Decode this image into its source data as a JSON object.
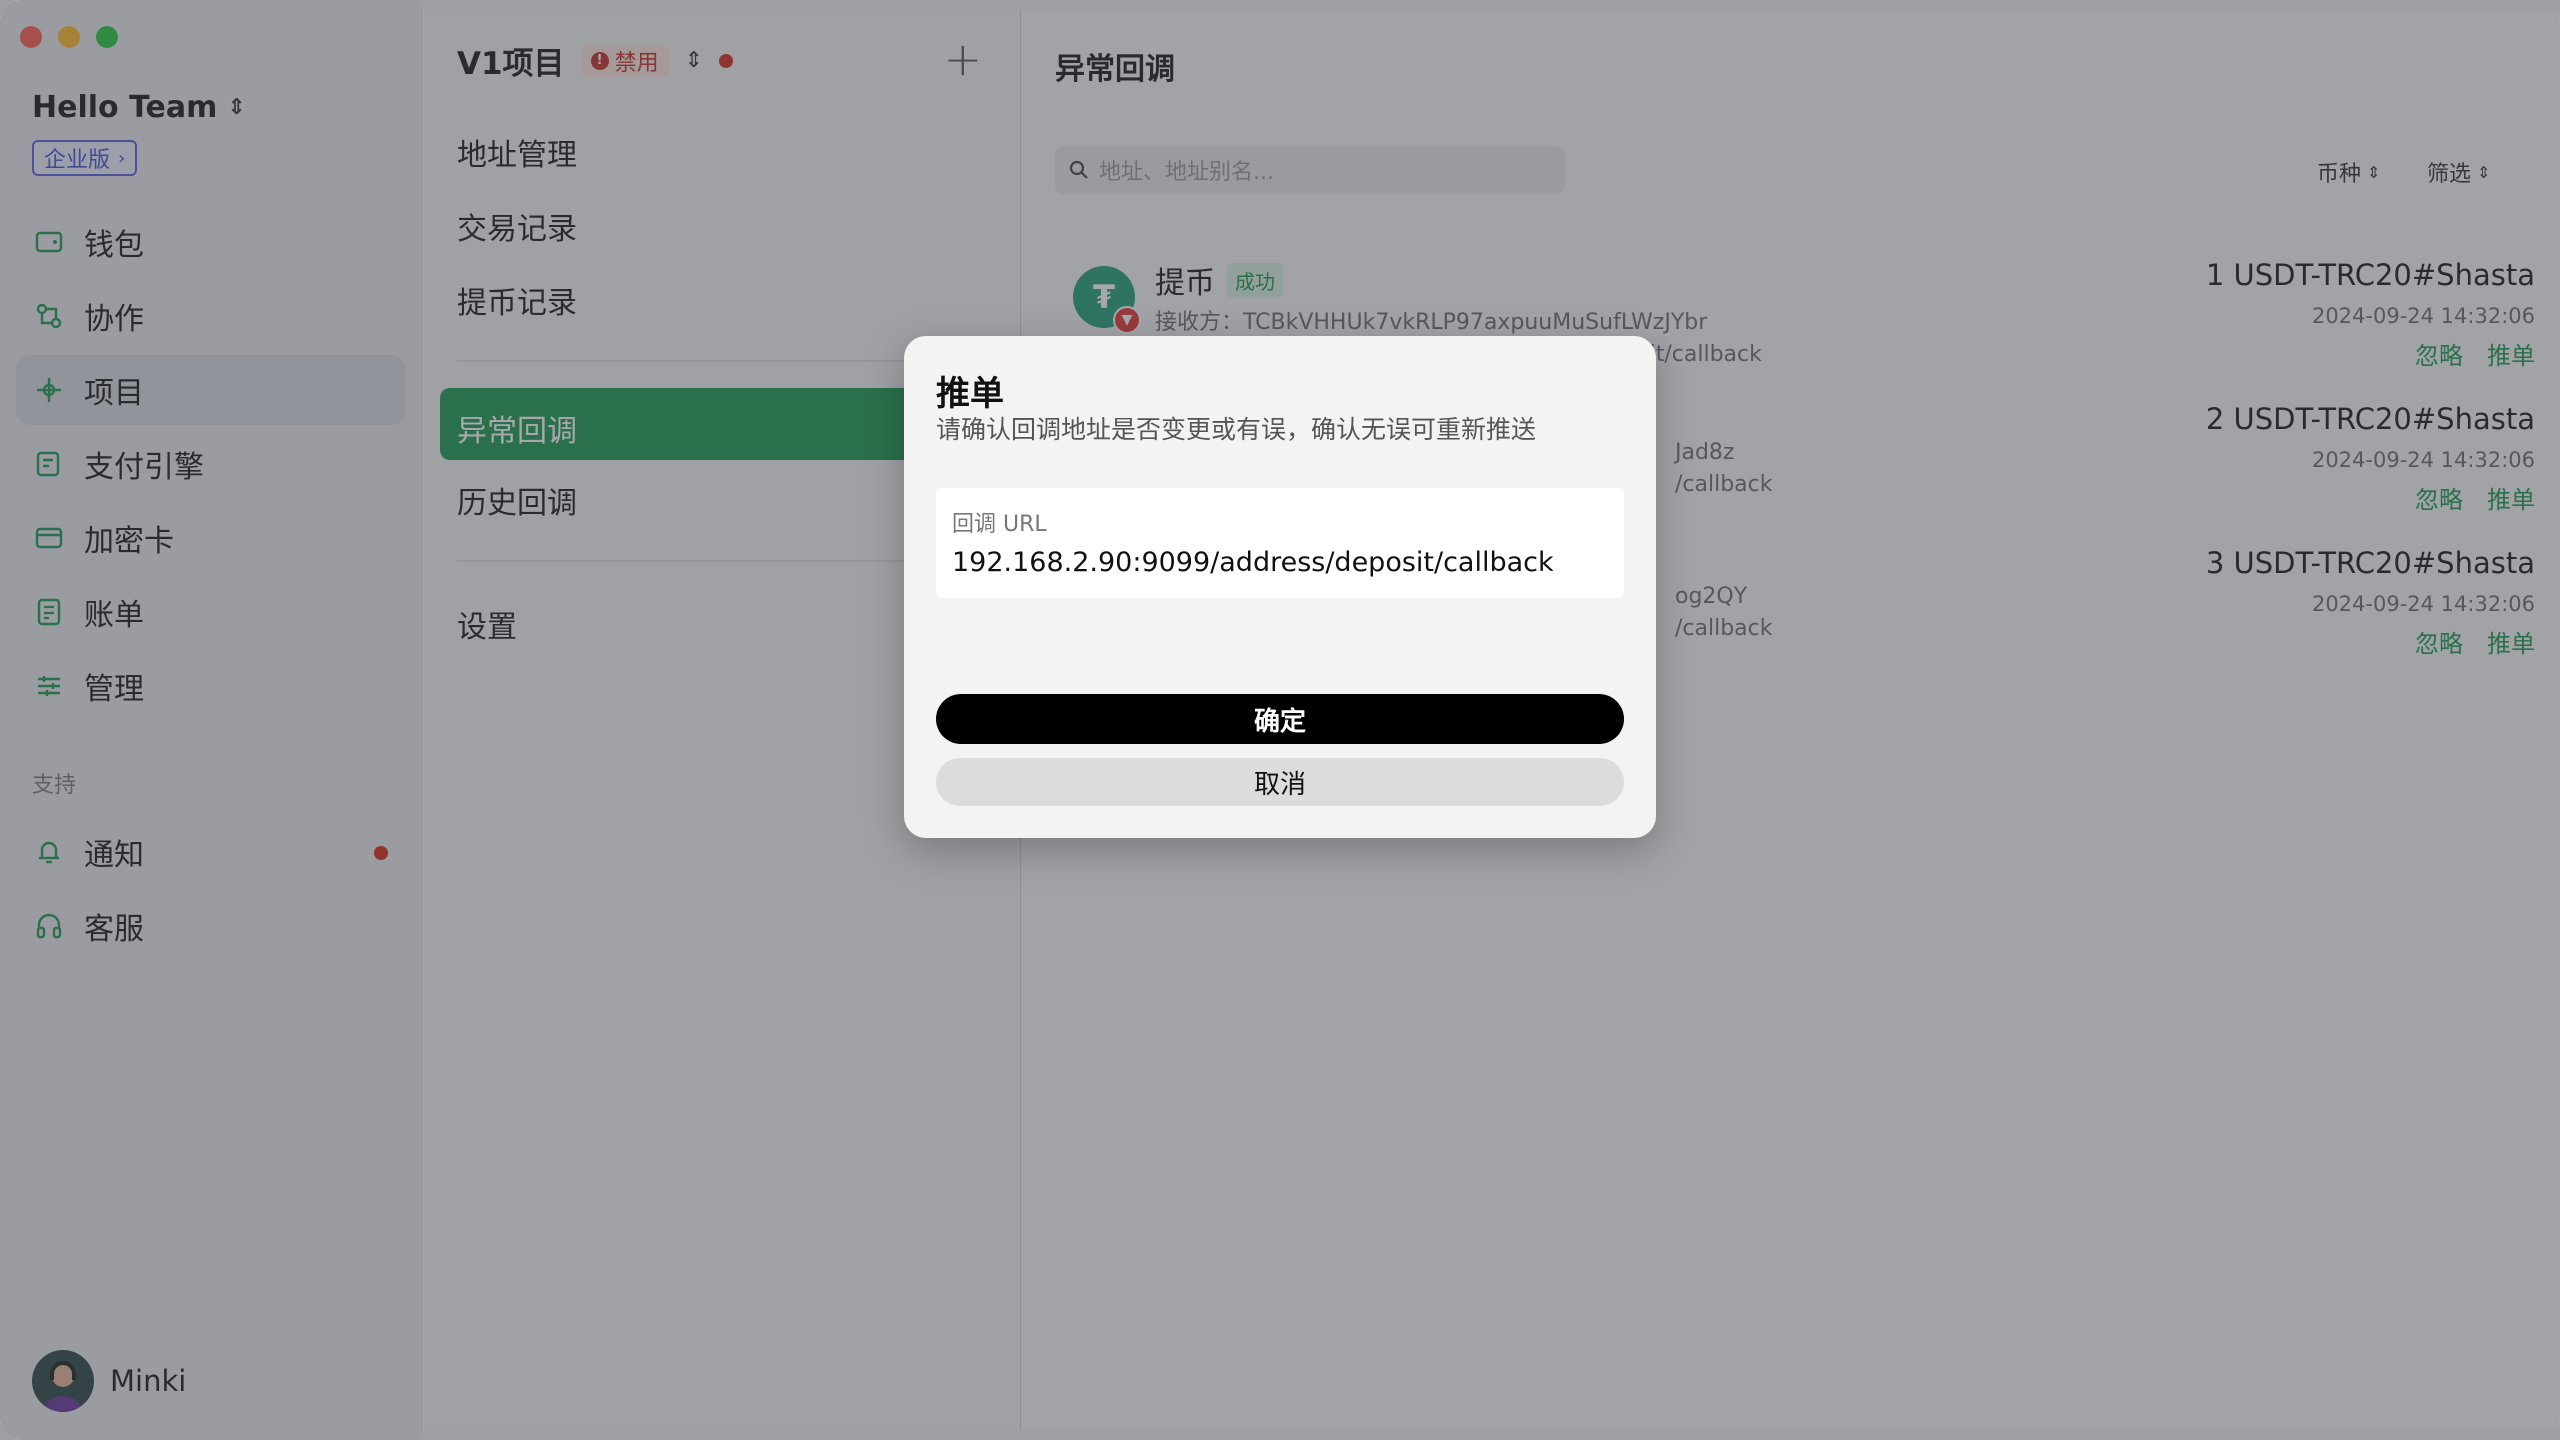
{
  "sidebar": {
    "team_name": "Hello Team",
    "plan_badge": "企业版",
    "nav": [
      {
        "label": "钱包",
        "icon": "wallet-icon"
      },
      {
        "label": "协作",
        "icon": "collaborate-icon"
      },
      {
        "label": "项目",
        "icon": "project-icon",
        "active": true
      },
      {
        "label": "支付引擎",
        "icon": "payment-engine-icon"
      },
      {
        "label": "加密卡",
        "icon": "crypto-card-icon"
      },
      {
        "label": "账单",
        "icon": "bill-icon"
      },
      {
        "label": "管理",
        "icon": "manage-icon"
      }
    ],
    "support_label": "支持",
    "support_nav": [
      {
        "label": "通知",
        "icon": "bell-icon",
        "has_dot": true
      },
      {
        "label": "客服",
        "icon": "headset-icon"
      }
    ],
    "user_name": "Minki"
  },
  "project": {
    "title": "V1项目",
    "status_badge": "禁用",
    "menu": [
      {
        "label": "地址管理"
      },
      {
        "label": "交易记录"
      },
      {
        "label": "提币记录"
      },
      {
        "label": "异常回调",
        "active": true
      },
      {
        "label": "历史回调"
      },
      {
        "label": "设置"
      }
    ]
  },
  "content": {
    "title": "异常回调",
    "search_placeholder": "地址、地址别名...",
    "filter_coin": "币种",
    "filter_screen": "筛选",
    "rows": [
      {
        "type": "提币",
        "status": "成功",
        "line1": "接收方：TCBkVHHUk7vkRLP97axpuuMuSufLWzJYbr",
        "line2": "回调 URL：192.168.2.90:9099/address/deposit/callback",
        "amount": "1 USDT-TRC20#Shasta",
        "time": "2024-09-24 14:32:06",
        "ignore": "忽略",
        "push": "推单"
      },
      {
        "line1": "Jad8z",
        "line2": "/callback",
        "amount": "2 USDT-TRC20#Shasta",
        "time": "2024-09-24 14:32:06",
        "ignore": "忽略",
        "push": "推单"
      },
      {
        "line1": "og2QY",
        "line2": "/callback",
        "amount": "3 USDT-TRC20#Shasta",
        "time": "2024-09-24 14:32:06",
        "ignore": "忽略",
        "push": "推单"
      }
    ]
  },
  "dialog": {
    "title": "推单",
    "description": "请确认回调地址是否变更或有误，确认无误可重新推送",
    "field_label": "回调 URL",
    "field_value": "192.168.2.90:9099/address/deposit/callback",
    "confirm": "确定",
    "cancel": "取消"
  },
  "colors": {
    "accent_green": "#1d9a53",
    "danger_red": "#d72b1c",
    "usdt_green": "#26a17b"
  }
}
